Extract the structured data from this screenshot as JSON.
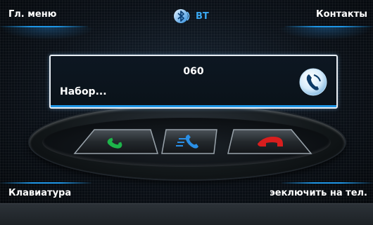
{
  "header": {
    "menu_label": "Гл. меню",
    "contacts_label": "Контакты",
    "bt_label": "BT"
  },
  "call": {
    "number": "060",
    "status": "Набор..."
  },
  "footer": {
    "keypad_label": "Клавиатура",
    "switch_label": "эеключить на тел."
  },
  "icons": {
    "bluetooth": "bluetooth-icon",
    "phone": "phone-icon",
    "accept": "phone-green-icon",
    "transfer": "phone-transfer-icon",
    "reject": "phone-red-icon"
  },
  "colors": {
    "accent": "#1e96e6",
    "accept": "#1db44a",
    "reject": "#d81e1e",
    "transfer": "#2a8fe6"
  }
}
